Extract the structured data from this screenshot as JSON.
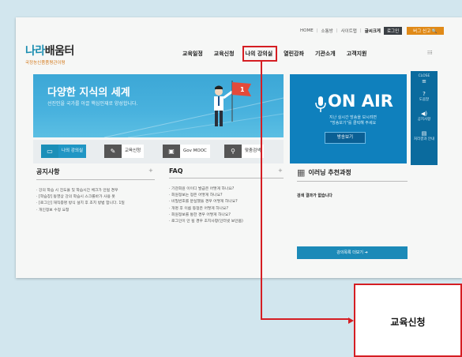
{
  "util_links": [
    "HOME",
    "소통방",
    "사이트맵"
  ],
  "util_wide": "글씨크게",
  "login_label": "로그인",
  "bug_label": "버그 신고 🔍",
  "logo": {
    "title_a": "나라",
    "title_b": "배움터",
    "subtitle": "국정농신품품평관이평"
  },
  "gnb": [
    "교육일정",
    "교육신청",
    "나의 강의실",
    "열린강좌",
    "기관소개",
    "고객지원"
  ],
  "gnb_menu_icon": "grid-icon",
  "banner": {
    "title": "다양한 지식의 세계",
    "subtitle": "선진인을 국가를 아끌 핵심인재로 양성합니다."
  },
  "onair": {
    "title": "ON AIR",
    "desc_line1": "지난 실시간 방송을 보시려면",
    "desc_line2": "\"방송보기\"를 클릭해 주세요",
    "watch_label": "방송보기"
  },
  "sidebar_items": [
    {
      "label": "CLOSE",
      "icon": "menu-icon"
    },
    {
      "label": "도움말",
      "icon": "help-icon"
    },
    {
      "label": "공지사항",
      "icon": "speaker-icon"
    },
    {
      "label": "처리결과 안내",
      "icon": "doc-icon"
    }
  ],
  "quick_links": [
    {
      "label": "나의 강의실",
      "icon": "monitor-icon"
    },
    {
      "label": "교육신청",
      "icon": "form-icon"
    },
    {
      "label": "Gov MOOC",
      "icon": "screen-icon"
    },
    {
      "label": "맞춤검색",
      "icon": "search-icon"
    }
  ],
  "notice": {
    "title": "공지사항",
    "items": [
      "· 강의 학습 시 진도율 및 학습시간 체크가 안될 경우",
      "· [학습창] 동영상 강의 학습시 스크롤바가 사용 못",
      "· [로그인] 재직증명 방식 설치 후 초치 방법 합니다. 1일",
      "· 개인정보 수정 요청"
    ]
  },
  "faq": {
    "title": "FAQ",
    "items": [
      "· 기관회원 이이디 발급은 어떻게 하나요?",
      "· 회원정보는 정은 어떻게 하나요?",
      "· 비밀번호를 분실했을 경우 어떻게 하나요?",
      "· 개명 후 이름 등정은 어떻게 하나요?",
      "· 회원정보를 통한 경우 어떻게 하나요?",
      "· 로그인이 안 될 경우 조치사항(인터넷 보안옵)"
    ]
  },
  "recommend": {
    "title": "이러닝 추천과정",
    "message": "검색 결과가 없습니다",
    "more_label": "강의목록 더보기 ➔"
  },
  "callout_label": "교육신청",
  "colors": {
    "highlight": "#d51e23",
    "banner": "#3ca7d6",
    "onair": "#0f80bd",
    "sidebar": "#0b6b9e"
  }
}
